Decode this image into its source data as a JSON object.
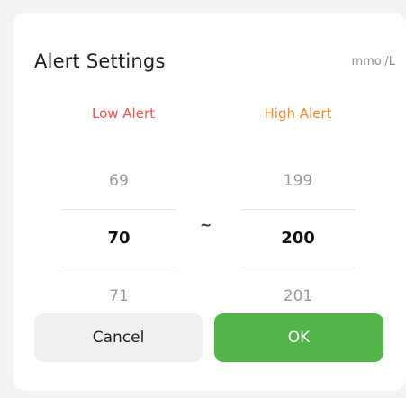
{
  "dialog": {
    "title": "Alert Settings",
    "unit": "mmol/L"
  },
  "columns": {
    "low_label": "Low Alert",
    "high_label": "High Alert",
    "separator": "~"
  },
  "low_picker": {
    "prev": "69",
    "selected": "70",
    "next": "71"
  },
  "high_picker": {
    "prev": "199",
    "selected": "200",
    "next": "201"
  },
  "buttons": {
    "cancel_label": "Cancel",
    "ok_label": "OK"
  },
  "colors": {
    "low_accent": "#ef5350",
    "high_accent": "#ef8a2e",
    "ok_button": "#52b54a"
  }
}
